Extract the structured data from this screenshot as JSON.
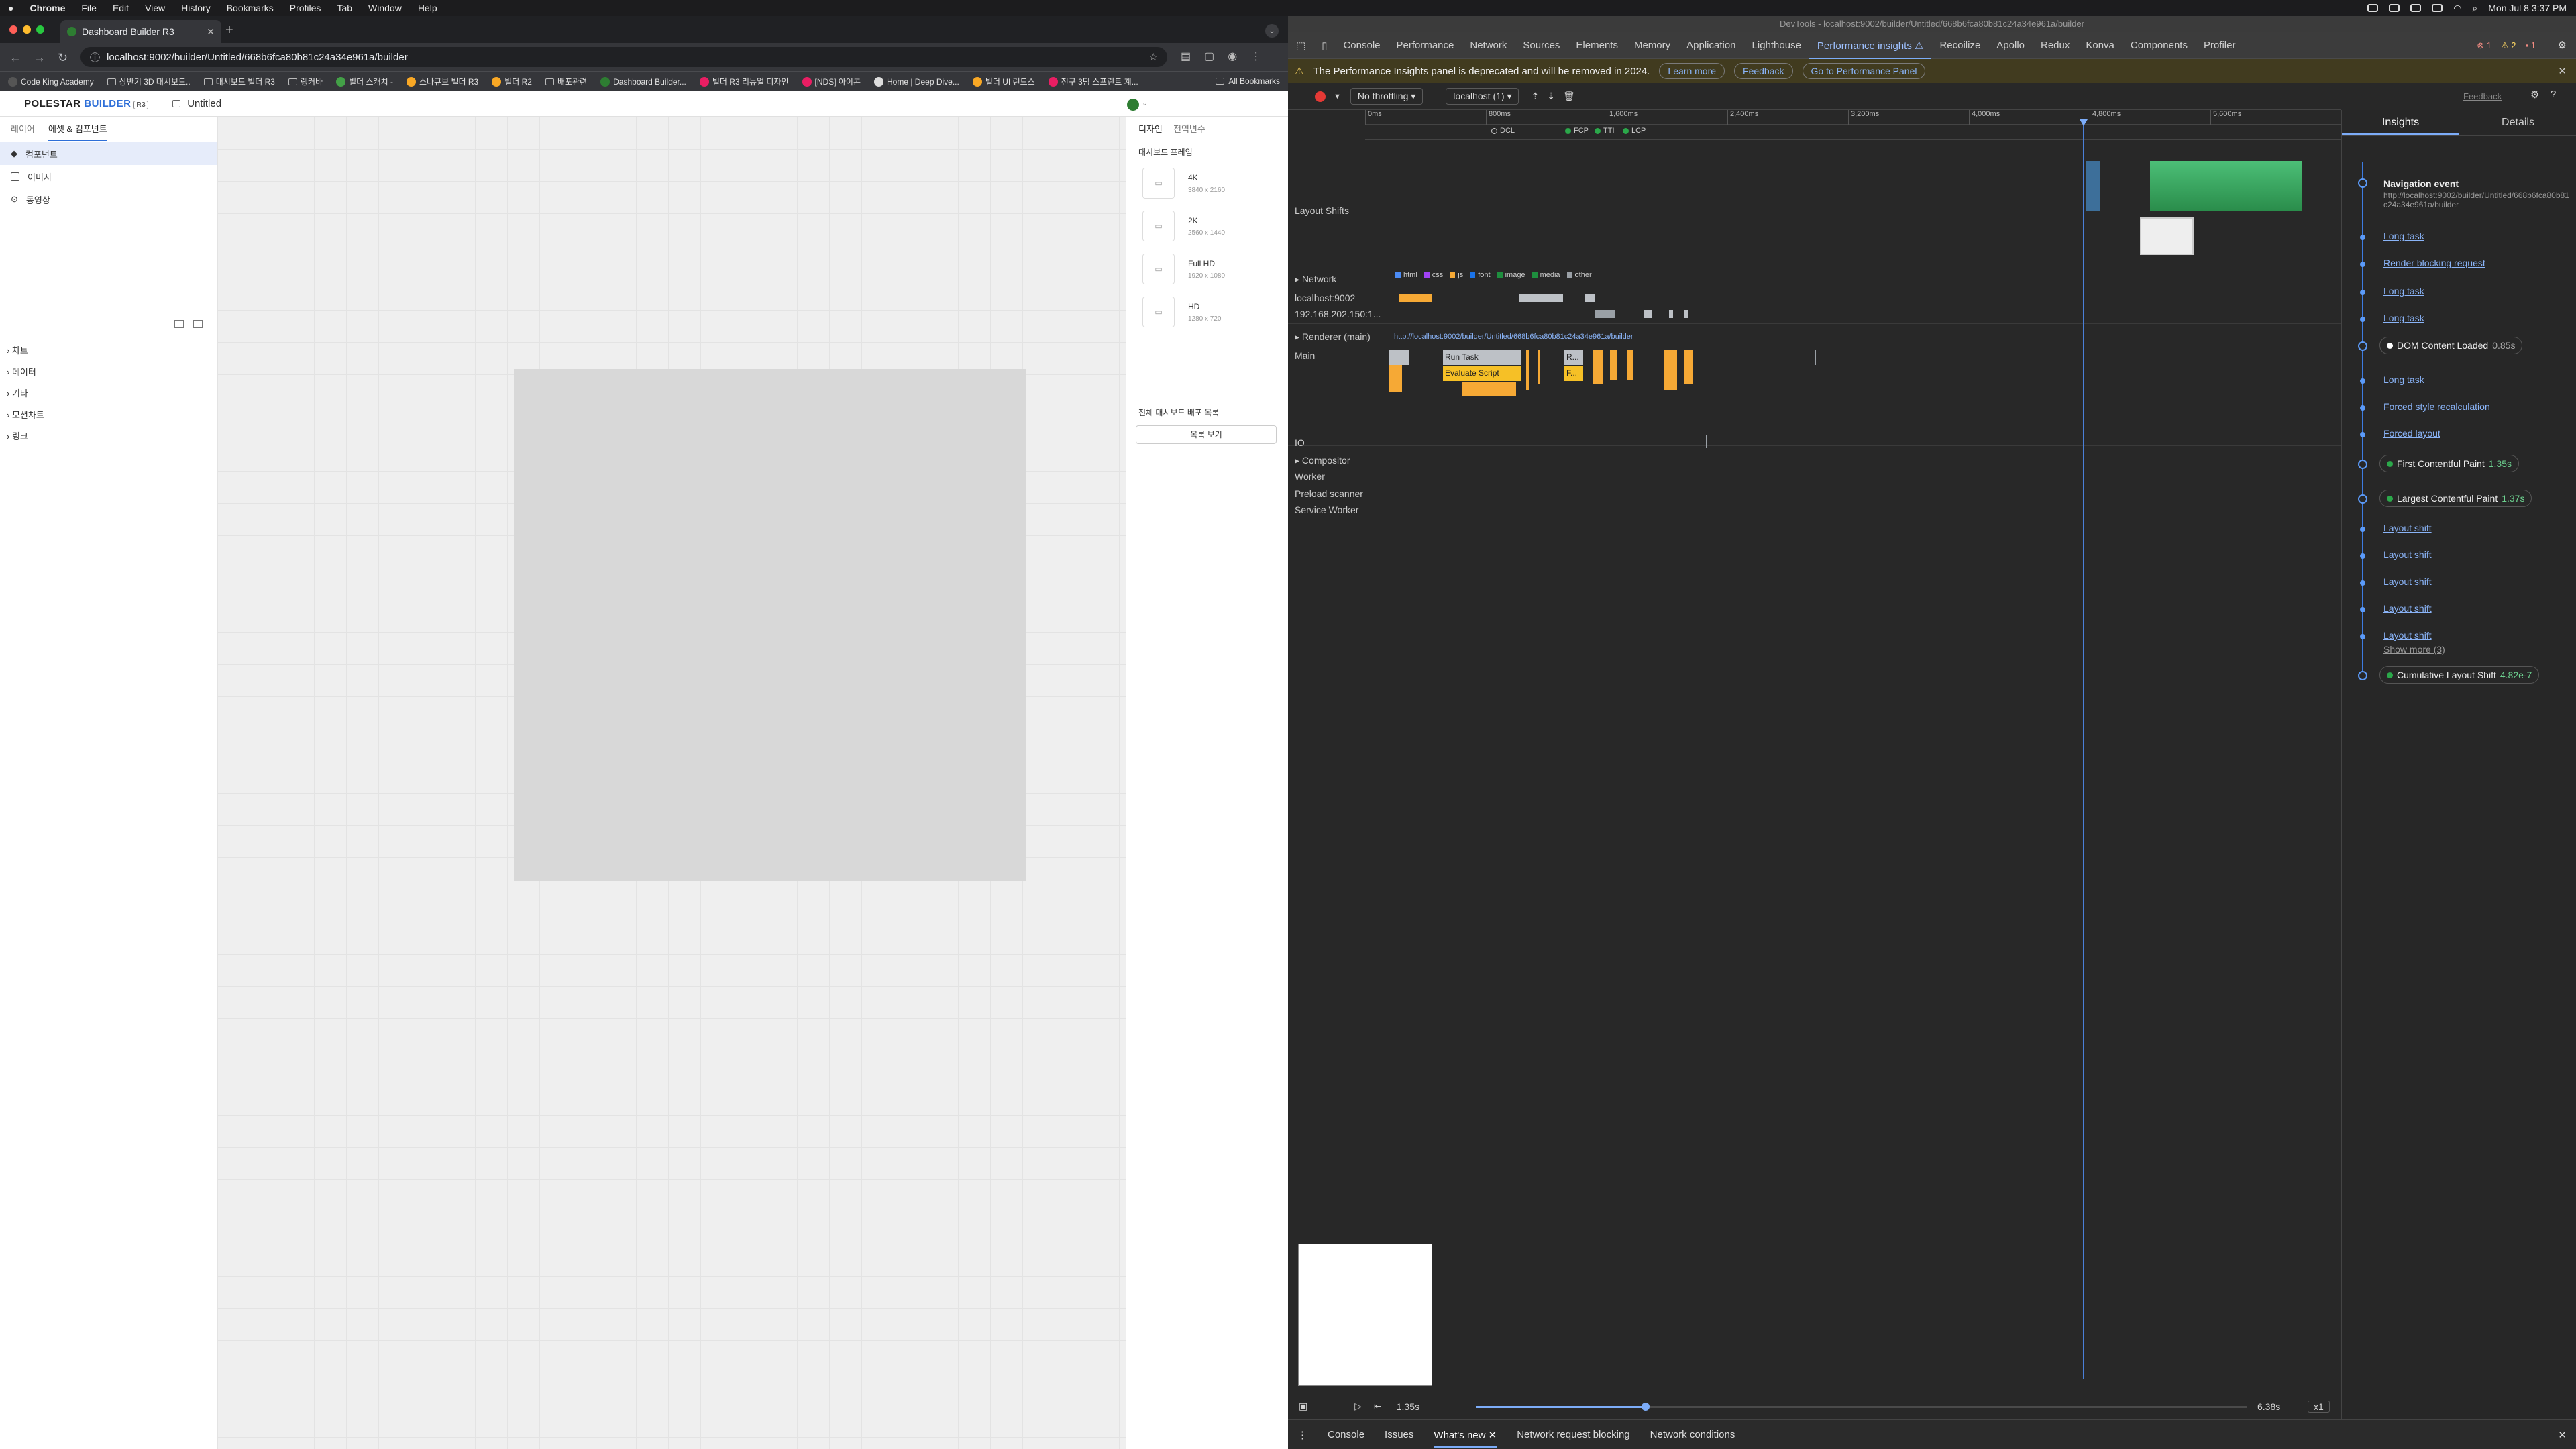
{
  "menubar": {
    "app": "Chrome",
    "items": [
      "File",
      "Edit",
      "View",
      "History",
      "Bookmarks",
      "Profiles",
      "Tab",
      "Window",
      "Help"
    ],
    "clock": "Mon Jul 8  3:37 PM"
  },
  "browser": {
    "tab_title": "Dashboard Builder R3",
    "url": "localhost:9002/builder/Untitled/668b6fca80b81c24a34e961a/builder",
    "bookmarks": [
      "Code King Academy",
      "상반기 3D 대시보드..",
      "대시보드 빌더 R3",
      "랭커바",
      "빌더 스캐치 -",
      "소나큐브 빌더 R3",
      "빌더 R2",
      "배포관련",
      "Dashboard Builder...",
      "빌더 R3 리뉴얼 디자인",
      "[NDS] 아이콘",
      "Home | Deep Dive...",
      "빌더 UI 런드스",
      "전구 3팀 스프린트 계..."
    ],
    "all_bookmarks": "All Bookmarks"
  },
  "app": {
    "logo_main": "POLESTAR",
    "logo_accent": "BUILDER",
    "logo_version": "R3",
    "doc_title": "Untitled",
    "left_tabs": [
      "레이어",
      "에셋 & 컴포넌트"
    ],
    "left_items": [
      "컴포넌트",
      "이미지",
      "동영상"
    ],
    "left_groups": [
      "차트",
      "데이터",
      "기타",
      "모션차트",
      "링크"
    ],
    "right_tabs": [
      "디자인",
      "전역변수"
    ],
    "preset_label": "대시보드 프레임",
    "presets": [
      {
        "name": "4K",
        "size": "3840 x 2160"
      },
      {
        "name": "2K",
        "size": "2560 x 1440"
      },
      {
        "name": "Full HD",
        "size": "1920 x 1080"
      },
      {
        "name": "HD",
        "size": "1280 x 720"
      }
    ],
    "all_list_label": "전체 대시보드 배포 목록",
    "list_button": "목록 보기"
  },
  "devtools": {
    "window_title": "DevTools - localhost:9002/builder/Untitled/668b6fca80b81c24a34e961a/builder",
    "tabs": [
      "Console",
      "Performance",
      "Network",
      "Sources",
      "Elements",
      "Memory",
      "Application",
      "Lighthouse",
      "Performance insights ⚠",
      "Recoilize",
      "Apollo",
      "Redux",
      "Konva",
      "Components",
      "Profiler"
    ],
    "status": {
      "errors": "1",
      "warnings": "2",
      "issues": "1"
    },
    "warning": "The Performance Insights panel is deprecated and will be removed in 2024.",
    "warn_buttons": [
      "Learn more",
      "Feedback",
      "Go to Performance Panel"
    ],
    "throttling": "No throttling",
    "target": "localhost (1)",
    "feedback": "Feedback",
    "ruler": [
      "0ms",
      "800ms",
      "1,600ms",
      "2,400ms",
      "3,200ms",
      "4,000ms",
      "4,800ms",
      "5,600ms"
    ],
    "markers": [
      "DCL",
      "FCP",
      "TTI",
      "LCP"
    ],
    "tracks": {
      "layout_shifts": "Layout Shifts",
      "network": "Network",
      "network_rows": [
        "localhost:9002",
        "192.168.202.150:1..."
      ],
      "legend": [
        "html",
        "css",
        "js",
        "font",
        "image",
        "media",
        "other"
      ],
      "renderer": "Renderer (main)",
      "renderer_url": "http://localhost:9002/builder/Untitled/668b6fca80b81c24a34e961a/builder",
      "main": "Main",
      "flames": [
        "Run Task",
        "Evaluate Script",
        "R...",
        "F..."
      ],
      "others": [
        "IO",
        "Compositor",
        "Worker",
        "Preload scanner",
        "Service Worker"
      ]
    },
    "playback": {
      "current": "1.35s",
      "total": "6.38s",
      "speed": "x1",
      "progress": 0.22
    },
    "drawer_tabs": [
      "Console",
      "Issues",
      "What's new",
      "Network request blocking",
      "Network conditions"
    ],
    "insights_tabs": [
      "Insights",
      "Details"
    ],
    "insights": {
      "nav_title": "Navigation event",
      "nav_url": "http://localhost:9002/builder/Untitled/668b6fca80b81c24a34e961a/builder",
      "long_task": "Long task",
      "render_blocking": "Render blocking request",
      "dcl": "DOM Content Loaded",
      "dcl_v": "0.85s",
      "forced_recalc": "Forced style recalculation",
      "forced_layout": "Forced layout",
      "fcp": "First Contentful Paint",
      "fcp_v": "1.35s",
      "lcp": "Largest Contentful Paint",
      "lcp_v": "1.37s",
      "layout_shift": "Layout shift",
      "show_more": "Show more (3)",
      "cls": "Cumulative Layout Shift",
      "cls_v": "4.82e-7"
    }
  }
}
